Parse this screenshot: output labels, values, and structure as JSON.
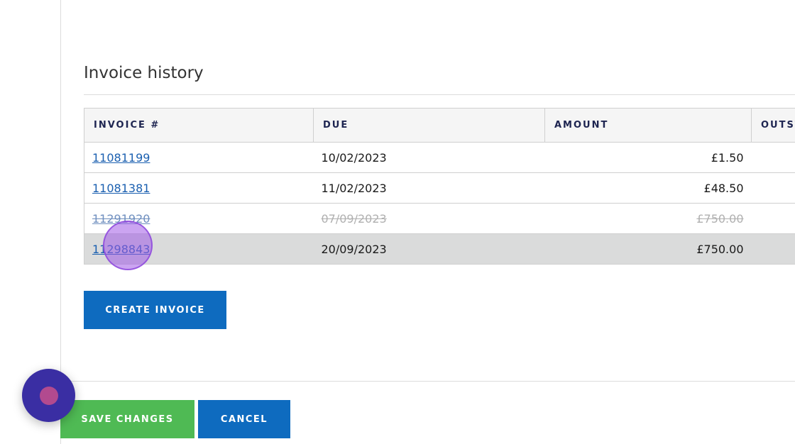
{
  "section": {
    "title": "Invoice history"
  },
  "table": {
    "headers": [
      "INVOICE #",
      "DUE",
      "AMOUNT",
      "OUTST"
    ],
    "rows": [
      {
        "invoice": "11081199",
        "due": "10/02/2023",
        "amount": "£1.50",
        "state": "normal"
      },
      {
        "invoice": "11081381",
        "due": "11/02/2023",
        "amount": "£48.50",
        "state": "normal"
      },
      {
        "invoice": "11291920",
        "due": "07/09/2023",
        "amount": "£750.00",
        "state": "void"
      },
      {
        "invoice": "11298843",
        "due": "20/09/2023",
        "amount": "£750.00",
        "state": "selected"
      }
    ]
  },
  "actions": {
    "create_invoice": "CREATE INVOICE",
    "save_changes": "SAVE CHANGES",
    "cancel": "CANCEL"
  },
  "colors": {
    "primary_blue": "#0e6bbf",
    "save_green": "#4fba54",
    "link": "#1a5fb0",
    "header_text": "#1d2450",
    "selected_row": "#dadbdb"
  },
  "icons": {
    "chat_widget": "chat-bubble-icon"
  }
}
